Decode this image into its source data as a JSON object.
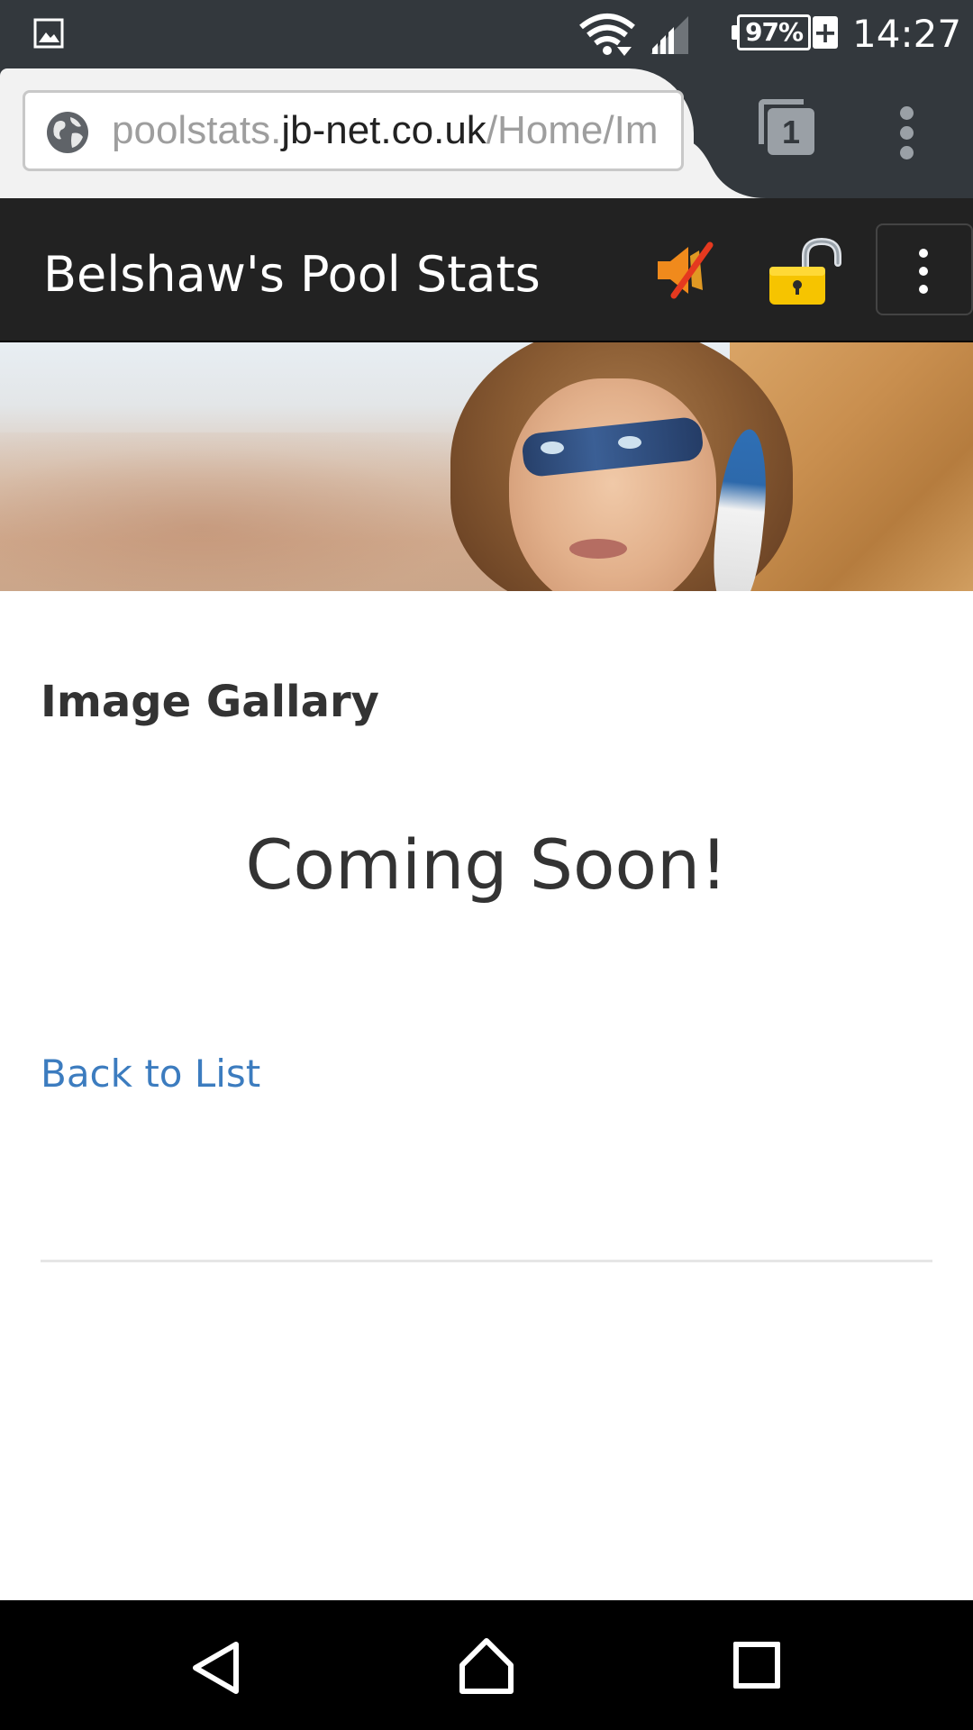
{
  "status_bar": {
    "battery_percent": "97%",
    "time": "14:27",
    "icons": [
      "gallery-icon",
      "wifi-icon",
      "signal-icon",
      "battery-icon",
      "charging-icon"
    ]
  },
  "browser": {
    "url_prefix": "poolstats.",
    "url_domain": "jb-net.co.uk",
    "url_path": "/Home/Im",
    "tab_count": "1"
  },
  "navbar": {
    "brand": "Belshaw's Pool Stats",
    "icons": [
      "mute-icon",
      "unlock-icon",
      "menu-icon"
    ]
  },
  "content": {
    "heading": "Image Gallary",
    "message": "Coming Soon!",
    "back_link": "Back to List"
  },
  "colors": {
    "status_bar_bg": "#33383d",
    "navbar_bg": "#222222",
    "link": "#3c7cbf",
    "text": "#333333"
  }
}
